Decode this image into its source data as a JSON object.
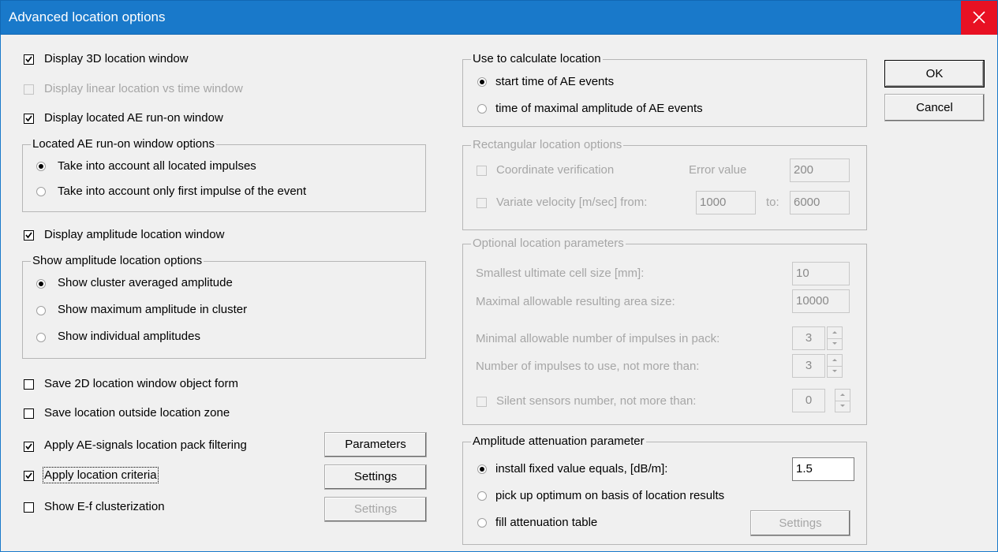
{
  "window": {
    "title": "Advanced location options"
  },
  "colors": {
    "titlebar": "#1979ca",
    "close_hover": "#e81123",
    "disabled_text": "#a6a6a6"
  },
  "left": {
    "display_3d": {
      "label": "Display 3D location window",
      "checked": true
    },
    "display_linear": {
      "label": "Display linear location vs time window",
      "checked": false,
      "enabled": false
    },
    "display_runon": {
      "label": "Display located AE run-on window",
      "checked": true
    },
    "runon_group": {
      "title": "Located AE run-on window options",
      "options": [
        "Take into account all located impulses",
        "Take into account only first impulse of the event"
      ],
      "selected": 0
    },
    "display_amplitude": {
      "label": "Display amplitude location window",
      "checked": true
    },
    "amplitude_group": {
      "title": "Show amplitude location options",
      "options": [
        "Show cluster averaged amplitude",
        "Show maximum amplitude in cluster",
        "Show individual amplitudes"
      ],
      "selected": 0
    },
    "save_2d": {
      "label": "Save 2D location window object form",
      "checked": false
    },
    "save_outside": {
      "label": "Save location outside location zone",
      "checked": false
    },
    "apply_pack": {
      "label": "Apply AE-signals location pack filtering",
      "checked": true,
      "button": "Parameters"
    },
    "apply_criteria": {
      "label": "Apply location criteria",
      "checked": true,
      "button": "Settings"
    },
    "show_ef": {
      "label": "Show E-f clusterization",
      "checked": false,
      "button": "Settings",
      "button_enabled": false
    }
  },
  "calc_group": {
    "title": "Use to calculate location",
    "options": [
      "start time of AE events",
      "time of maximal amplitude of AE events"
    ],
    "selected": 0
  },
  "rect_group": {
    "title": "Rectangular location options",
    "coord_verification": "Coordinate verification",
    "error_value_label": "Error value",
    "error_value": "200",
    "variate_velocity": "Variate velocity [m/sec]  from:",
    "from_value": "1000",
    "to_label": "to:",
    "to_value": "6000"
  },
  "optional_group": {
    "title": "Optional location parameters",
    "cell_size_label": "Smallest ultimate cell size [mm]:",
    "cell_size": "10",
    "area_size_label": "Maximal allowable resulting area size:",
    "area_size": "10000",
    "min_impulses_label": "Minimal allowable number of impulses in pack:",
    "min_impulses": "3",
    "num_impulses_label": "Number of impulses to use, not more than:",
    "num_impulses": "3",
    "silent_label": "Silent sensors number, not more than:",
    "silent": "0"
  },
  "atten_group": {
    "title": "Amplitude attenuation parameter",
    "options": [
      "install fixed value equals, [dB/m]:",
      "pick up optimum on basis of location results",
      "fill attenuation table"
    ],
    "selected": 0,
    "fixed_value": "1.5",
    "settings_button": "Settings"
  },
  "buttons": {
    "ok": "OK",
    "cancel": "Cancel"
  }
}
